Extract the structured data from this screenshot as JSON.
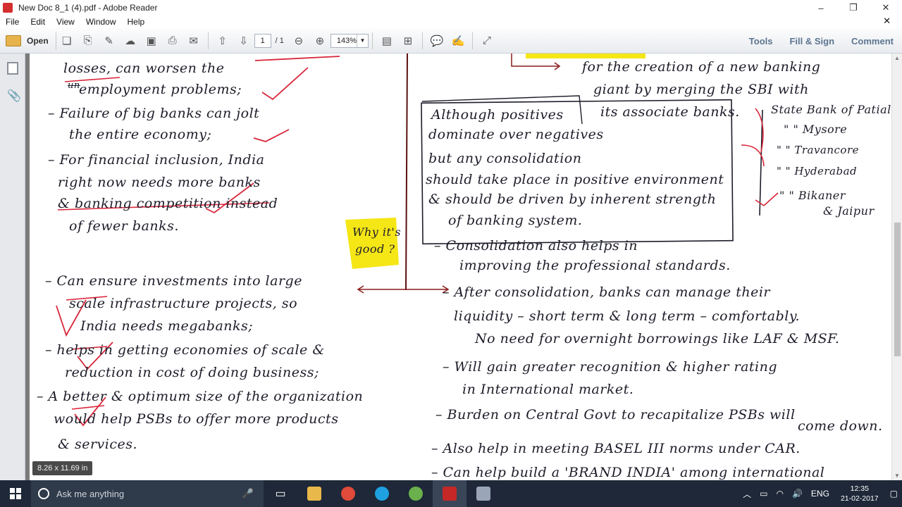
{
  "window": {
    "title": "New Doc 8_1 (4).pdf - Adobe Reader",
    "controls": [
      "–",
      "❐",
      "✕"
    ]
  },
  "menu": {
    "items": [
      "File",
      "Edit",
      "View",
      "Window",
      "Help"
    ],
    "close": "✕"
  },
  "toolbar": {
    "open_label": "Open",
    "page_current": "1",
    "page_total": "/ 1",
    "zoom": "143%",
    "tools_label": "Tools",
    "fill_sign_label": "Fill & Sign",
    "comment_label": "Comment"
  },
  "doc": {
    "left": [
      "losses, can worsen the",
      "employment problems;",
      "– Failure of big banks can jolt",
      "the entire economy;",
      "– For financial inclusion, India",
      "right now needs more banks",
      "& banking competition instead",
      "of fewer banks.",
      "– Can ensure investments into large",
      "scale infrastructure projects, so",
      "India needs megabanks;",
      "– helps in getting economies of scale &",
      "reduction in cost of doing business;",
      "– A better & optimum size of the organization",
      "would help PSBs to offer more products",
      "& services."
    ],
    "strike_prefix": "un",
    "why_note": [
      "Why it's",
      "good ?"
    ],
    "right_top": [
      "for the creation of a new banking",
      "giant by merging the SBI with",
      "its associate banks."
    ],
    "box": [
      "Although positives",
      "dominate over negatives",
      "but any consolidation",
      "should take place in positive environment",
      "& should be driven by inherent strength",
      "of banking system."
    ],
    "banks": [
      "State Bank of Patiala",
      "\"    \" Mysore",
      "\"    \" Travancore",
      "\"    \" Hyderabad",
      "\"    \" Bikaner",
      "& Jaipur"
    ],
    "right": [
      "– Consolidation also helps in",
      "improving the professional standards.",
      "– After consolidation, banks can manage their",
      "liquidity – short term & long term – comfortably.",
      "No need for overnight borrowings like LAF & MSF.",
      "– Will gain greater recognition & higher rating",
      "in International market.",
      "– Burden on Central Govt to recapitalize PSBs will",
      "come down.",
      "– Also help in meeting BASEL III norms under CAR.",
      "– Can help build a 'BRAND INDIA' among international"
    ]
  },
  "size_tooltip": "8.26 x 11.69 in",
  "taskbar": {
    "search_placeholder": "Ask me anything",
    "lang": "ENG",
    "time": "12:35",
    "date": "21-02-2017"
  },
  "colors": {
    "ink": "#1d1d2a",
    "red_pen": "#d8263a",
    "highlight": "#f5e616",
    "taskbar": "#1e2838"
  }
}
